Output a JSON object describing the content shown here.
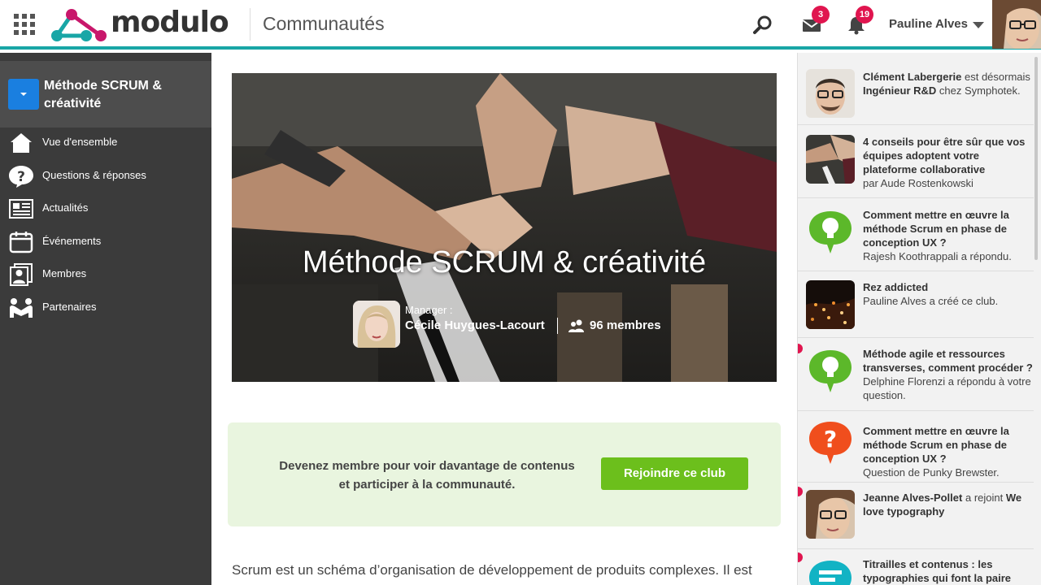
{
  "header": {
    "logo_text": "modulo",
    "section_title": "Communautés",
    "messages_count": "3",
    "notifications_count": "19",
    "user_name": "Pauline Alves",
    "icons": [
      "apps-grid-icon",
      "search-icon",
      "mail-icon",
      "bell-icon",
      "chevron-down-icon"
    ]
  },
  "sidebar": {
    "title": "Méthode SCRUM & créativité",
    "items": [
      {
        "label": "Vue d'ensemble",
        "icon": "home-icon"
      },
      {
        "label": "Questions & réponses",
        "icon": "question-bubble-icon"
      },
      {
        "label": "Actualités",
        "icon": "newspaper-icon"
      },
      {
        "label": "Événements",
        "icon": "calendar-icon"
      },
      {
        "label": "Membres",
        "icon": "members-icon"
      },
      {
        "label": "Partenaires",
        "icon": "handshake-icon"
      }
    ]
  },
  "main": {
    "hero_title": "Méthode SCRUM & créativité",
    "manager_label": "Manager :",
    "manager_name": "Cécile Huygues-Lacourt",
    "members_count": "96 membres",
    "join_text": "Devenez membre pour voir davantage de contenus et participer à la communauté.",
    "join_button": "Rejoindre ce club",
    "description": "Scrum est un schéma d’organisation de développement de produits complexes. Il est"
  },
  "feed": [
    {
      "p1_bold": "Clément Labergerie",
      "p1": " est désormais ",
      "p2_bold": "Ingénieur R&D",
      "p2": " chez Symphotek.",
      "thumb": "avatar-man-glasses",
      "unread": false
    },
    {
      "title": "4 conseils pour être sûr que vos équipes adoptent votre plateforme collaborative",
      "sub": "par Aude Rostenkowski",
      "thumb": "photo-hands",
      "unread": false
    },
    {
      "title": "Comment mettre en œuvre la méthode Scrum en phase de conception UX ?",
      "sub": "Rajesh Koothrappali a répondu.",
      "thumb": "lightbulb-icon",
      "unread": false
    },
    {
      "title": "Rez addicted",
      "sub": "Pauline Alves a créé ce club.",
      "thumb": "photo-city-night",
      "unread": false
    },
    {
      "title": "Méthode agile et ressources transverses, comment procéder ?",
      "sub": "Delphine Florenzi a répondu à votre question.",
      "thumb": "lightbulb-icon",
      "unread": true
    },
    {
      "title": "Comment mettre en œuvre la méthode Scrum en phase de conception UX ?",
      "sub": "Question de Punky Brewster.",
      "thumb": "question-icon",
      "unread": false
    },
    {
      "p1_bold": "Jeanne Alves-Pollet",
      "p1": " a rejoint ",
      "p2_bold": "We love typography",
      "p2": "",
      "thumb": "avatar-woman-glasses",
      "unread": true
    },
    {
      "title": "Titrailles et contenus : les typographies qui font la paire",
      "sub": "",
      "thumb": "document-icon",
      "unread": true
    }
  ],
  "colors": {
    "accent": "#18a6a6",
    "badge": "#e0154f",
    "join_button": "#6cbf1c",
    "join_box": "#e9f5df",
    "sidebar": "#3b3b3b",
    "toggle": "#1a7fe0",
    "lightbulb": "#5cb82a",
    "question": "#f04e1d"
  }
}
